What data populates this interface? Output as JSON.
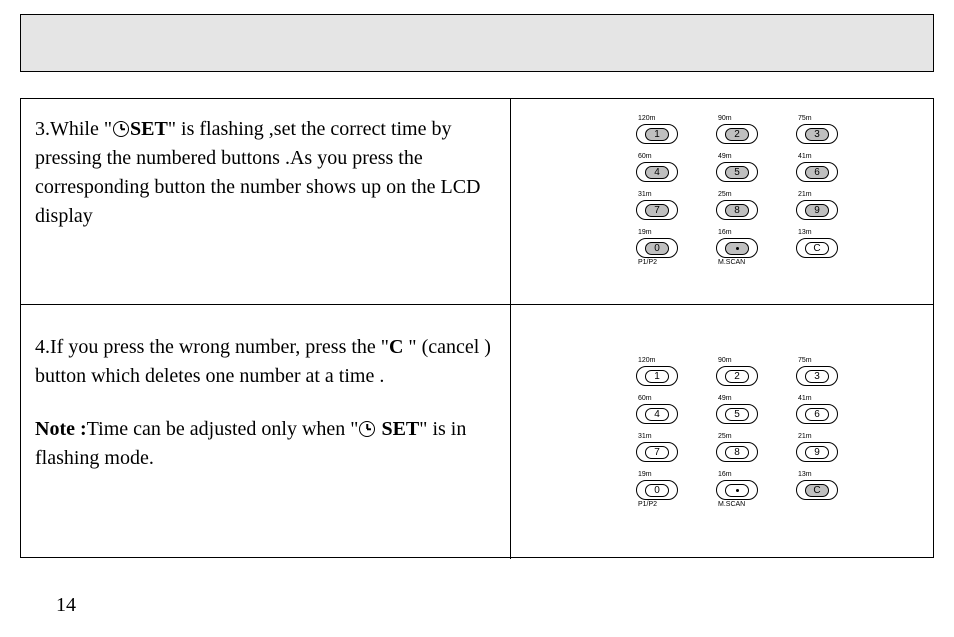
{
  "step3": {
    "prefix": "3.While \"",
    "set": "SET",
    "mid": "\"  is flashing ,set the correct time by pressing the numbered buttons .As you press the corresponding button the number shows up on the LCD display"
  },
  "step4": {
    "prefix": "4.If you press the wrong number, press the  \"",
    "c": "C ",
    "mid": "\" (cancel ) button which deletes one number at a  time .",
    "note_label": "Note :",
    "note_text_1": "Time can be adjusted only when  \"",
    "note_set": " SET",
    "note_text_2": "\"  is in flashing mode."
  },
  "keypad": {
    "labels_top": [
      "120m",
      "90m",
      "75m",
      "60m",
      "49m",
      "41m",
      "31m",
      "25m",
      "21m",
      "19m",
      "16m",
      "13m"
    ],
    "keys": [
      "1",
      "2",
      "3",
      "4",
      "5",
      "6",
      "7",
      "8",
      "9",
      "0",
      "•",
      "C"
    ],
    "labels_bottom": [
      "",
      "",
      "",
      "",
      "",
      "",
      "",
      "",
      "",
      "P1/P2",
      "M.SCAN",
      ""
    ]
  },
  "keypad1_filled": [
    0,
    1,
    2,
    3,
    4,
    5,
    6,
    7,
    8,
    9,
    10
  ],
  "keypad2_filled": [
    11
  ],
  "page_number": "14"
}
